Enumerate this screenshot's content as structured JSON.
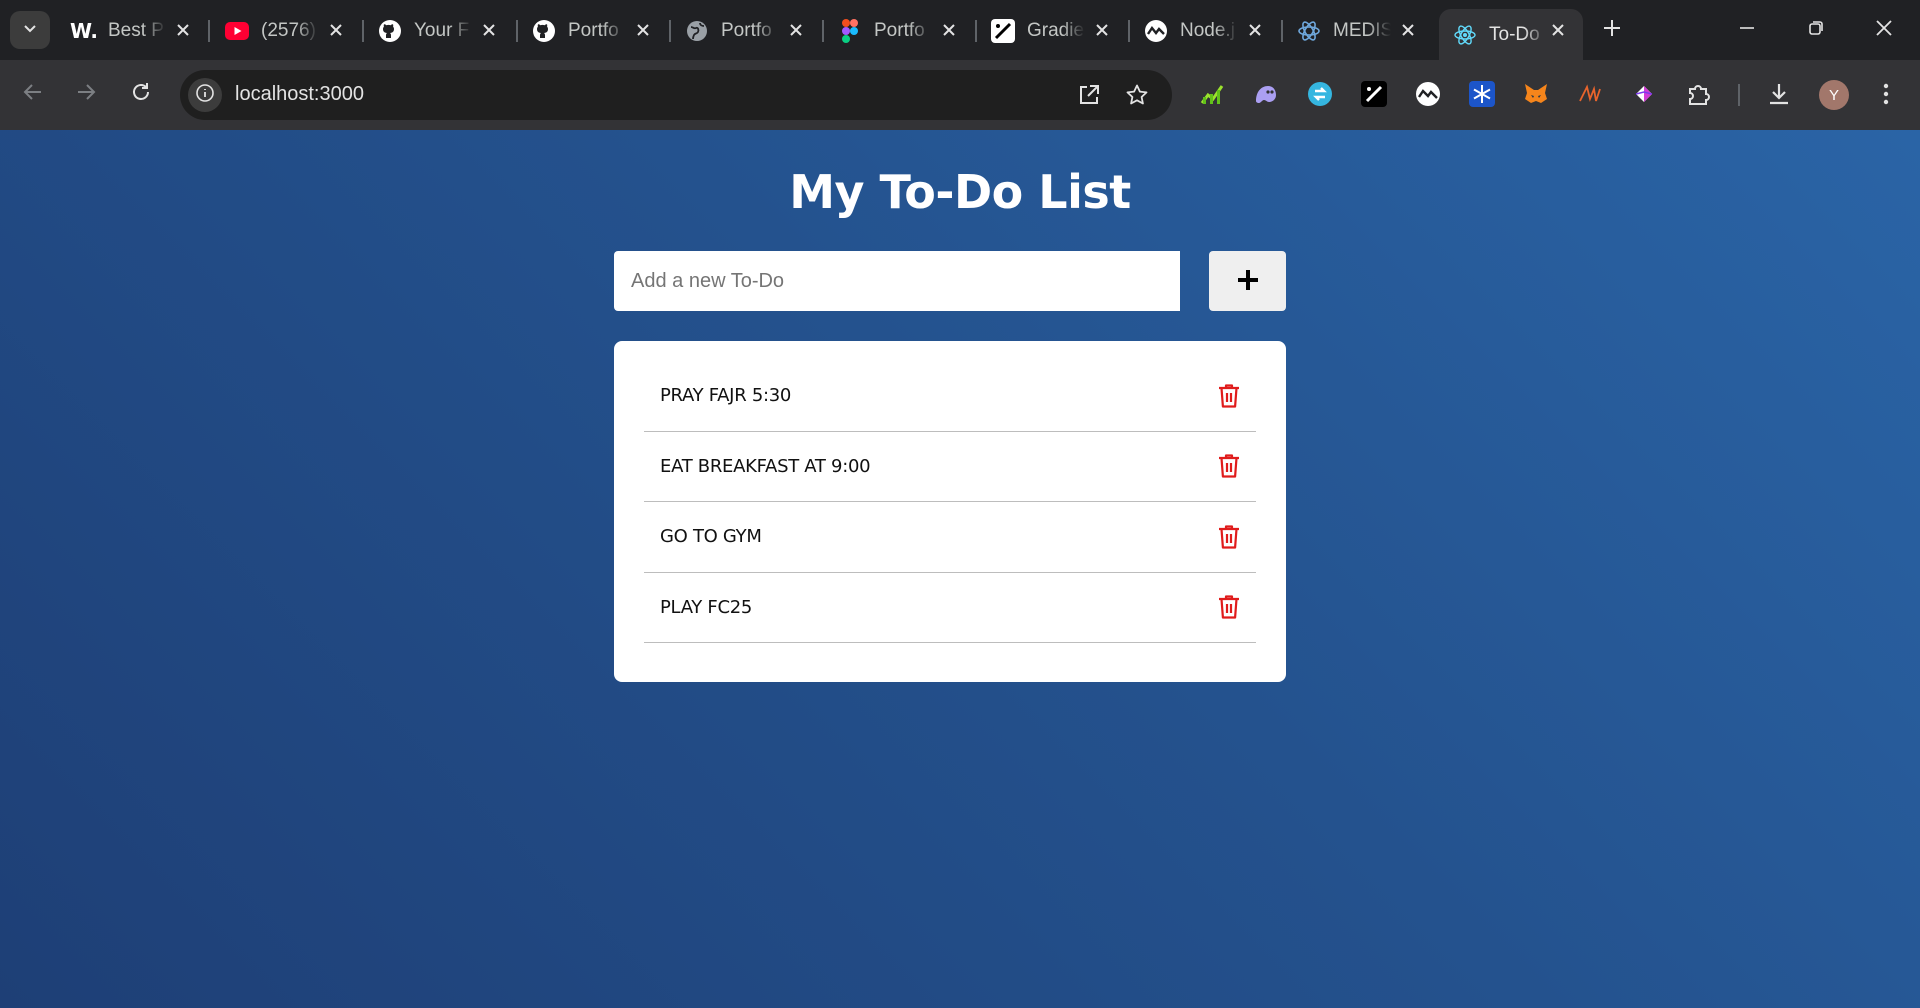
{
  "browser": {
    "tabs": [
      {
        "title": "Best P",
        "icon": "w-logo-icon"
      },
      {
        "title": "(2576)",
        "icon": "youtube-icon"
      },
      {
        "title": "Your F",
        "icon": "github-icon"
      },
      {
        "title": "Portfo",
        "icon": "github-icon"
      },
      {
        "title": "Portfo",
        "icon": "globe-icon"
      },
      {
        "title": "Portfo",
        "icon": "figma-icon"
      },
      {
        "title": "Gradie",
        "icon": "gradient-icon"
      },
      {
        "title": "Node.j",
        "icon": "nodejs-icon"
      },
      {
        "title": "MEDIS",
        "icon": "medis-icon"
      },
      {
        "title": "To-Do",
        "icon": "react-icon",
        "active": true
      }
    ],
    "url": "localhost:3000",
    "profile_initial": "Y",
    "extensions": [
      "chart-extension",
      "ghost-extension",
      "sync-extension",
      "gradient-extension",
      "node-extension",
      "snowflake-extension",
      "metamask-extension",
      "wave-extension",
      "diamond-extension",
      "puzzle-extension"
    ]
  },
  "app": {
    "title": "My To-Do List",
    "input": {
      "placeholder": "Add a new To-Do",
      "value": ""
    },
    "add_button_label": "+",
    "todos": [
      {
        "text": "PRAY FAJR 5:30"
      },
      {
        "text": "EAT BREAKFAST AT 9:00"
      },
      {
        "text": "GO TO GYM"
      },
      {
        "text": "PLAY FC25"
      }
    ]
  },
  "colors": {
    "background_start": "#1e3f76",
    "background_end": "#2a64a6",
    "delete_icon": "#e01c1c",
    "card": "#ffffff",
    "tab_active": "#333336"
  }
}
